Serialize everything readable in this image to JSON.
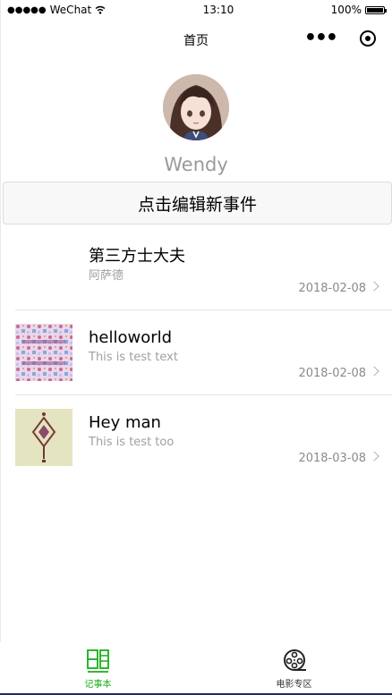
{
  "status_bar": {
    "carrier": "WeChat",
    "time": "13:10",
    "battery": "100%"
  },
  "nav": {
    "title": "首页"
  },
  "profile": {
    "username": "Wendy"
  },
  "edit_button": {
    "label": "点击编辑新事件"
  },
  "items": [
    {
      "title": "第三方士大夫",
      "subtitle": "阿萨德",
      "date": "2018-02-08",
      "thumb": "none"
    },
    {
      "title": "helloworld",
      "subtitle": "This is test text",
      "date": "2018-02-08",
      "thumb": "floral-pattern"
    },
    {
      "title": "Hey man",
      "subtitle": "This is test too",
      "date": "2018-03-08",
      "thumb": "diamond-ornament"
    }
  ],
  "tabs": [
    {
      "label": "记事本",
      "icon": "notebook-icon",
      "active": true
    },
    {
      "label": "电影专区",
      "icon": "film-reel-icon",
      "active": false
    }
  ],
  "colors": {
    "accent": "#1aad19",
    "muted_text": "#9a9a9a",
    "date_text": "#8a8a8a"
  }
}
